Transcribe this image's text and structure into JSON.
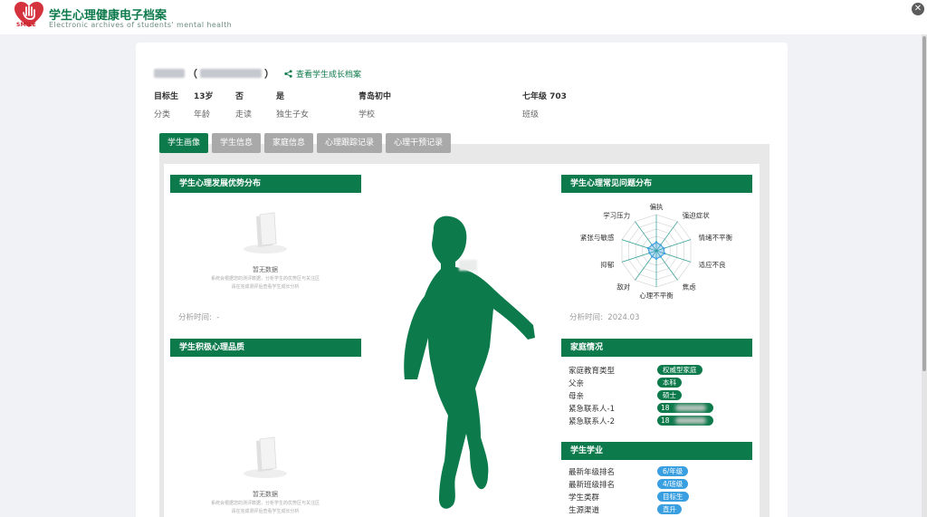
{
  "app": {
    "title": "学生心理健康电子档案",
    "subtitle": "Electronic archives of students' mental health",
    "logo_text": "SMILE",
    "brand_color": "#0d7a4c"
  },
  "student": {
    "paren_open": "（",
    "paren_close": "）",
    "growth_link": "查看学生成长档案",
    "info": [
      {
        "value": "目标生",
        "label": "分类"
      },
      {
        "value": "13岁",
        "label": "年龄"
      },
      {
        "value": "否",
        "label": "走读"
      },
      {
        "value": "是",
        "label": "独生子女"
      },
      {
        "value": "青岛初中",
        "label": "学校"
      },
      {
        "value": "七年级 703",
        "label": "班级"
      }
    ]
  },
  "tabs": [
    {
      "label": "学生画像",
      "active": true
    },
    {
      "label": "学生信息",
      "active": false
    },
    {
      "label": "家庭信息",
      "active": false
    },
    {
      "label": "心理跟踪记录",
      "active": false
    },
    {
      "label": "心理干预记录",
      "active": false
    }
  ],
  "panels": {
    "advantage": {
      "title": "学生心理发展优势分布",
      "empty_title": "暂无数据",
      "empty_desc_1": "系统会根据您的测评数据，分析学生的优势区与关注区",
      "empty_desc_2": "请在完成测评后查看学生成长分析",
      "time_label": "分析时间:",
      "time_value": "-"
    },
    "positive": {
      "title": "学生积极心理品质",
      "empty_title": "暂无数据",
      "empty_desc_1": "系统会根据您的测评数据，分析学生的优势区与关注区",
      "empty_desc_2": "请在完成测评后查看学生成长分析"
    },
    "problems": {
      "title": "学生心理常见问题分布",
      "radar_axes": [
        "偏执",
        "强迫症状",
        "情绪不平衡",
        "适应不良",
        "焦虑",
        "心理不平衡",
        "敌对",
        "抑郁",
        "紧张与敏感",
        "学习压力"
      ],
      "radar_levels": 5,
      "radar_values": [
        1.2,
        1.0,
        1.1,
        1.2,
        1.0,
        1.1,
        1.0,
        1.0,
        1.2,
        1.0
      ],
      "radar_max": 5,
      "time_label": "分析时间:",
      "time_value": "2024.03"
    },
    "family": {
      "title": "家庭情况",
      "rows": [
        {
          "label": "家庭教育类型",
          "tag": "权威型家庭"
        },
        {
          "label": "父亲",
          "tag": "本科"
        },
        {
          "label": "母亲",
          "tag": "硕士"
        },
        {
          "label": "紧急联系人-1",
          "tag": "18"
        },
        {
          "label": "紧急联系人-2",
          "tag": "18"
        }
      ]
    },
    "study": {
      "title": "学生学业",
      "rows": [
        {
          "label": "最新年级排名",
          "tag": "6/年级"
        },
        {
          "label": "最新班级排名",
          "tag": "4/班级"
        },
        {
          "label": "学生类群",
          "tag": "目标生"
        },
        {
          "label": "生源渠道",
          "tag": "直升"
        }
      ]
    }
  }
}
